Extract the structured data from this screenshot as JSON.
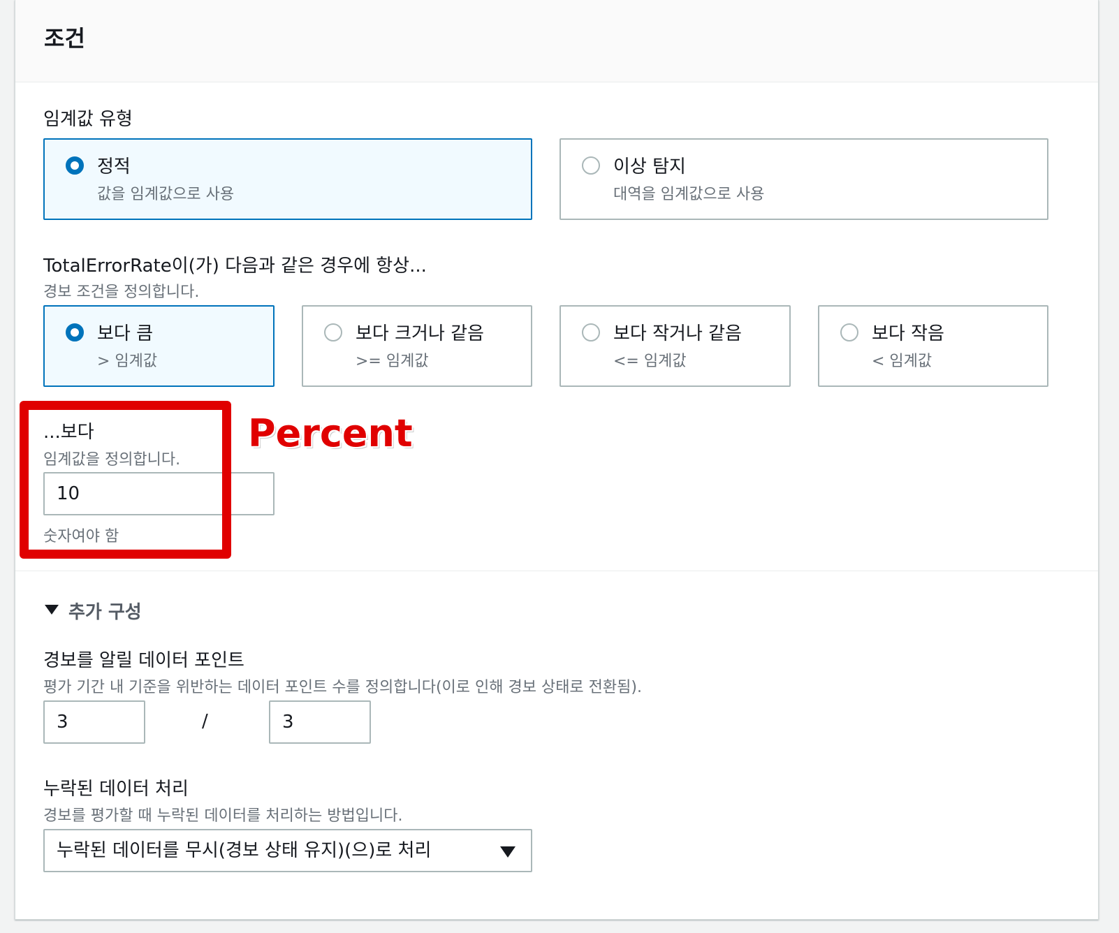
{
  "header": {
    "title": "조건"
  },
  "threshold_type": {
    "label": "임계값 유형",
    "options": [
      {
        "title": "정적",
        "sub": "값을 임계값으로 사용",
        "selected": true
      },
      {
        "title": "이상 탐지",
        "sub": "대역을 임계값으로 사용",
        "selected": false
      }
    ]
  },
  "condition": {
    "label": "TotalErrorRate이(가) 다음과 같은 경우에 항상...",
    "desc": "경보 조건을 정의합니다.",
    "options": [
      {
        "title": "보다 큼",
        "sub": "> 임계값",
        "selected": true
      },
      {
        "title": "보다 크거나 같음",
        "sub": ">= 임계값",
        "selected": false
      },
      {
        "title": "보다 작거나 같음",
        "sub": "<= 임계값",
        "selected": false
      },
      {
        "title": "보다 작음",
        "sub": "< 임계값",
        "selected": false
      }
    ]
  },
  "threshold": {
    "label": "...보다",
    "desc": "임계값을 정의합니다.",
    "value": "10",
    "hint": "숫자여야 함"
  },
  "annotation": {
    "text": "Percent",
    "color": "#e00000"
  },
  "additional": {
    "toggle_label": "추가 구성",
    "datapoints": {
      "label": "경보를 알릴 데이터 포인트",
      "desc": "평가 기간 내 기준을 위반하는 데이터 포인트 수를 정의합니다(이로 인해 경보 상태로 전환됨).",
      "value_a": "3",
      "separator": "/",
      "value_b": "3"
    },
    "missing": {
      "label": "누락된 데이터 처리",
      "desc": "경보를 평가할 때 누락된 데이터를 처리하는 방법입니다.",
      "selected": "누락된 데이터를 무시(경보 상태 유지)(으)로 처리"
    }
  },
  "colors": {
    "accent": "#0073bb",
    "selected_bg": "#f1faff",
    "border": "#aab7b8",
    "muted_text": "#687078"
  }
}
